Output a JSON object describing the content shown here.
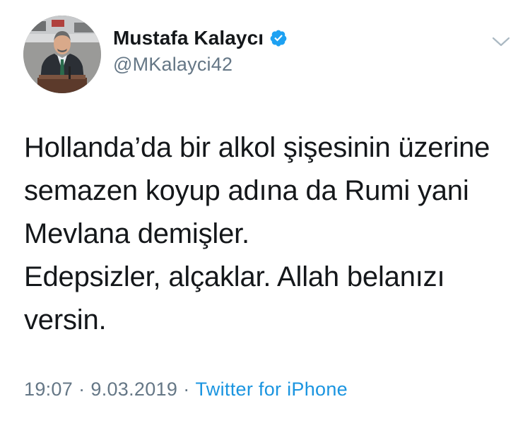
{
  "author": {
    "display_name": "Mustafa Kalaycı",
    "handle": "@MKalayci42",
    "verified": true,
    "avatar_icon": "profile-photo"
  },
  "tweet": {
    "lines": [
      "Hollanda’da bir alkol şişesinin üzerine",
      "semazen koyup adına da Rumi yani",
      "Mevlana demişler.",
      "Edepsizler, alçaklar. Allah belanızı",
      "versin."
    ]
  },
  "meta": {
    "time": "19:07",
    "separator": "·",
    "date": "9.03.2019",
    "source": "Twitter for iPhone"
  },
  "colors": {
    "text": "#14171a",
    "secondary_text": "#657786",
    "link": "#1b95e0",
    "verified_badge": "#1da1f2"
  },
  "icons": {
    "verified": "verified-badge-icon",
    "menu": "chevron-down-icon"
  }
}
